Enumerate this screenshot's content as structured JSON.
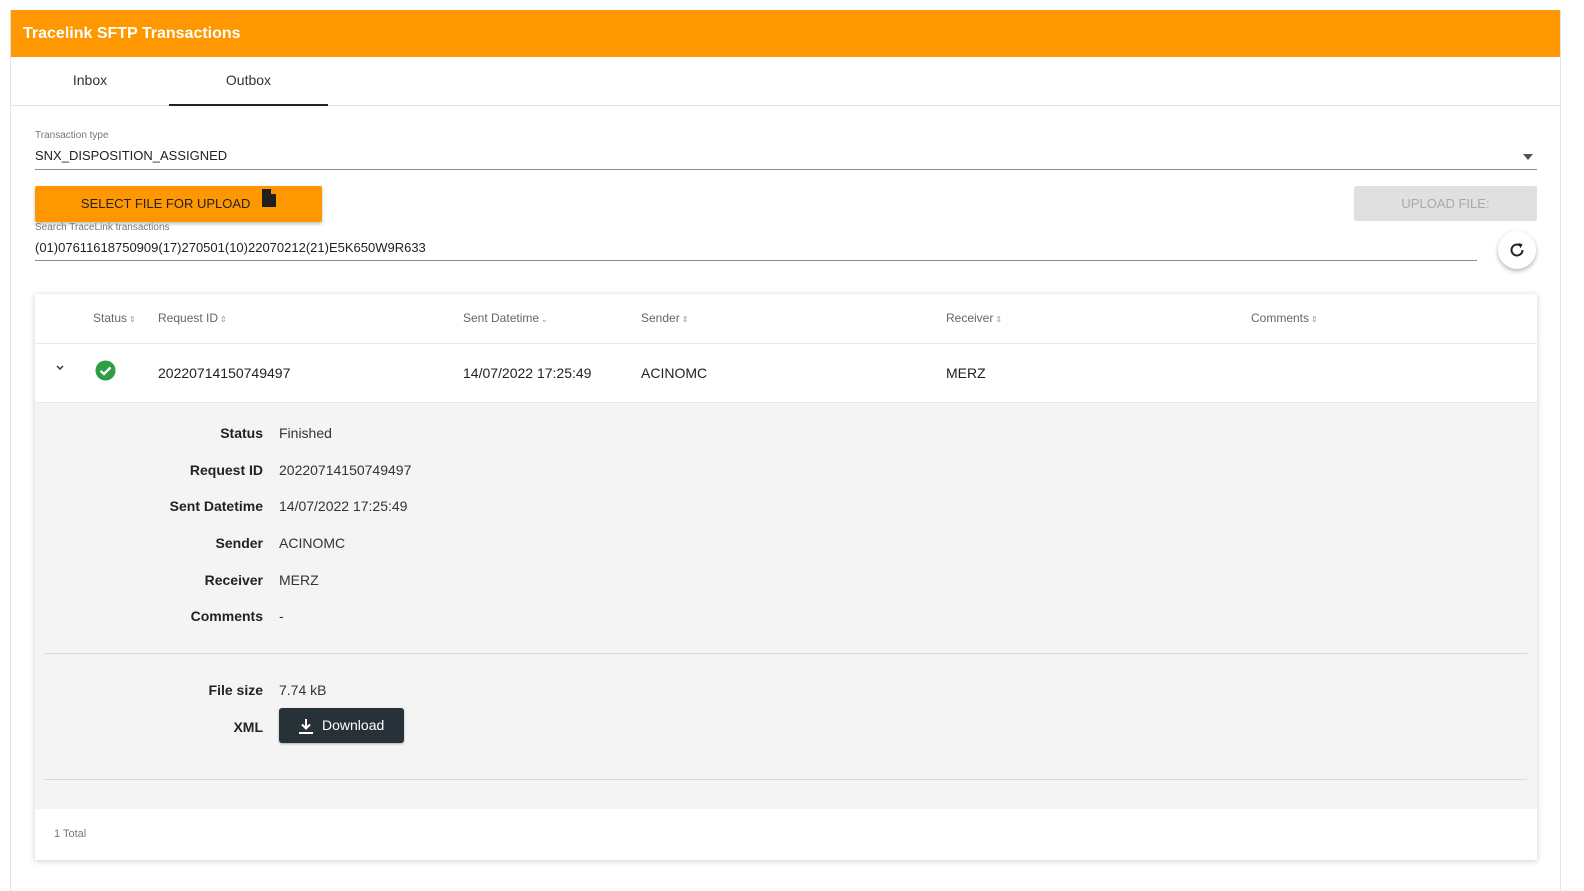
{
  "app": {
    "title": "Tracelink SFTP Transactions"
  },
  "tabs": [
    {
      "label": "Inbox"
    },
    {
      "label": "Outbox",
      "active": true
    }
  ],
  "form": {
    "transaction_type_label": "Transaction type",
    "transaction_type_value": "SNX_DISPOSITION_ASSIGNED",
    "select_file_label": "SELECT FILE FOR UPLOAD",
    "upload_label": "UPLOAD FILE:",
    "search_label": "Search TraceLink transactions",
    "search_value": "(01)07611618750909(17)270501(10)22070212(21)E5K650W9R633"
  },
  "table": {
    "headers": {
      "status": "Status",
      "request_id": "Request ID",
      "sent_datetime": "Sent Datetime",
      "sender": "Sender",
      "receiver": "Receiver",
      "comments": "Comments"
    },
    "rows": [
      {
        "request_id": "20220714150749497",
        "sent_datetime": "14/07/2022 17:25:49",
        "sender": "ACINOMC",
        "receiver": "MERZ",
        "status_icon": "check-circle-icon"
      }
    ],
    "details": {
      "status_label": "Status",
      "status_value": "Finished",
      "request_id_label": "Request ID",
      "request_id_value": "20220714150749497",
      "sent_label": "Sent Datetime",
      "sent_value": "14/07/2022 17:25:49",
      "sender_label": "Sender",
      "sender_value": "ACINOMC",
      "receiver_label": "Receiver",
      "receiver_value": "MERZ",
      "comments_label": "Comments",
      "comments_value": "-",
      "filesize_label": "File size",
      "filesize_value": "7.74 kB",
      "xml_label": "XML",
      "download_label": "Download"
    },
    "total": "1 Total"
  },
  "colors": {
    "accent": "#ff9800",
    "success": "#2e9e45",
    "dark_button": "#263238"
  }
}
